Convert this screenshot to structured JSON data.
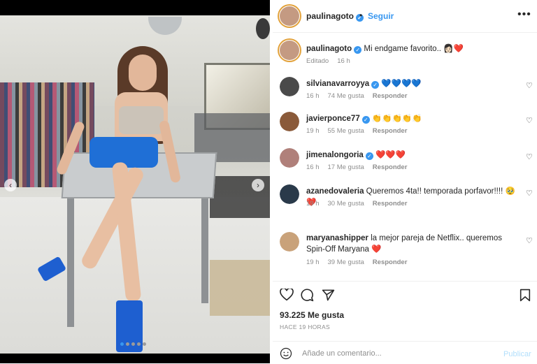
{
  "post": {
    "author": "paulinagoto",
    "follow_label": "Seguir",
    "separator": "•",
    "more_label": "•••",
    "caption_text": "Mi endgame favorito.. ",
    "caption_emoji": "👩🏻‍❤️",
    "caption_meta_status": "Editado",
    "caption_meta_time": "16 h",
    "likes": "93.225 Me gusta",
    "date": "HACE 19 HORAS",
    "comment_placeholder": "Añade un comentario...",
    "publish_label": "Publicar",
    "carousel_prev": "‹",
    "carousel_next": "›",
    "carousel_total_dots": 5,
    "carousel_active_index": 0
  },
  "comments": [
    {
      "user": "silvianavarroyya",
      "verified": true,
      "text": "",
      "emoji": "💙💙💙💙",
      "time": "16 h",
      "likes": "74 Me gusta",
      "reply": "Responder",
      "avatar_color": "#4a4a4a"
    },
    {
      "user": "javierponce77",
      "verified": true,
      "text": "",
      "emoji": "👏👏👏👏👏",
      "time": "19 h",
      "likes": "55 Me gusta",
      "reply": "Responder",
      "avatar_color": "#8a5a3a"
    },
    {
      "user": "jimenalongoria",
      "verified": true,
      "text": "",
      "emoji": "❤️❤️❤️",
      "time": "16 h",
      "likes": "17 Me gusta",
      "reply": "Responder",
      "avatar_color": "#b0807a"
    },
    {
      "user": "azanedovaleria",
      "verified": false,
      "text": "Queremos 4ta!! temporada porfavor!!!!",
      "emoji": "🥹❤️",
      "time": "19 h",
      "likes": "30 Me gusta",
      "reply": "Responder",
      "avatar_color": "#2a3a4a"
    },
    {
      "user": "maryanashipper",
      "verified": false,
      "text": "la mejor pareja de Netflix.. queremos Spin-Off Maryana",
      "emoji": "❤️",
      "time": "19 h",
      "likes": "39 Me gusta",
      "reply": "Responder",
      "avatar_color": "#c9a27a"
    }
  ],
  "icons": {
    "verified": "✓",
    "heart_outline": "♡"
  },
  "colors": {
    "accent_blue": "#3897f0",
    "muted": "#8e8e8e",
    "publish_disabled": "#b2dffc"
  }
}
